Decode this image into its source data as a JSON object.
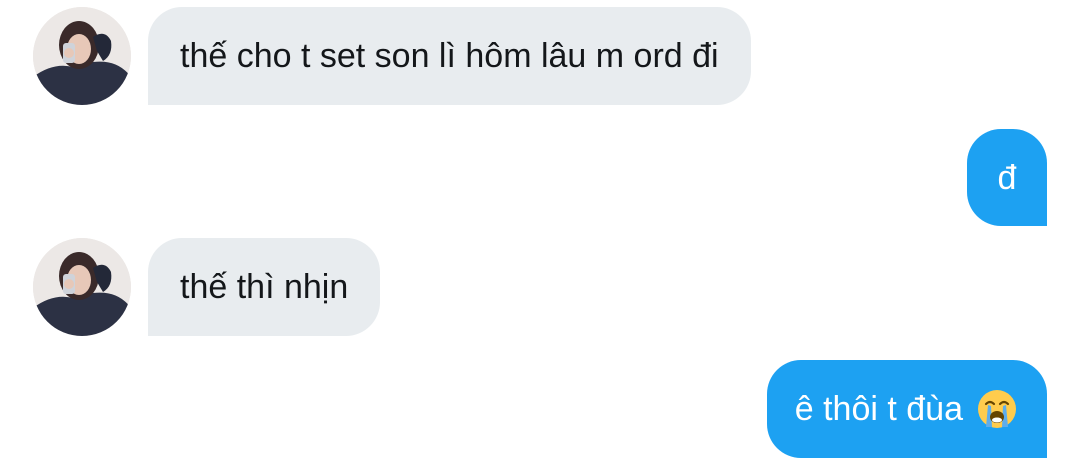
{
  "conversation": {
    "messages": [
      {
        "sender": "other",
        "text": "thế cho t set son lì hôm lâu m ord đi"
      },
      {
        "sender": "me",
        "text": "đ"
      },
      {
        "sender": "other",
        "text": "thế thì nhịn"
      },
      {
        "sender": "me",
        "text": "ê thôi t đùa",
        "emoji": "loudly-crying-face-icon"
      }
    ]
  },
  "colors": {
    "incoming_bubble": "#e8ecef",
    "outgoing_bubble": "#1da1f2",
    "incoming_text": "#14171a",
    "outgoing_text": "#ffffff"
  }
}
